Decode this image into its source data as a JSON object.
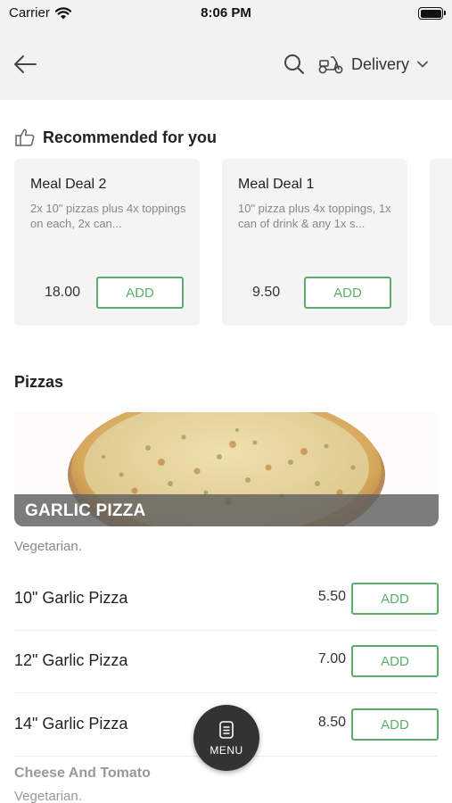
{
  "status_bar": {
    "carrier": "Carrier",
    "time": "8:06 PM"
  },
  "nav": {
    "delivery_label": "Delivery"
  },
  "recommended": {
    "title": "Recommended for you",
    "items": [
      {
        "name": "Meal Deal 2",
        "description": "2x 10\" pizzas plus 4x toppings on each, 2x can...",
        "price": "18.00",
        "add_label": "ADD"
      },
      {
        "name": "Meal Deal 1",
        "description": "10\" pizza plus 4x toppings, 1x can of drink & any 1x s...",
        "price": "9.50",
        "add_label": "ADD"
      }
    ]
  },
  "category": {
    "section_title": "Pizzas",
    "banner_title": "GARLIC PIZZA",
    "description": "Vegetarian.",
    "items": [
      {
        "name": "10\" Garlic Pizza",
        "price": "5.50",
        "add_label": "ADD"
      },
      {
        "name": "12\" Garlic Pizza",
        "price": "7.00",
        "add_label": "ADD"
      },
      {
        "name": "14\" Garlic Pizza",
        "price": "8.50",
        "add_label": "ADD"
      }
    ]
  },
  "next_category": {
    "title": "Cheese And Tomato",
    "description": "Vegetarian."
  },
  "menu_button": {
    "label": "MENU"
  },
  "colors": {
    "accent_green": "#5aae6c",
    "nav_background": "#f2f2f2",
    "fab_background": "#333333"
  },
  "icons": {
    "back": "back-arrow-icon",
    "search": "search-icon",
    "delivery": "scooter-icon",
    "chevron": "chevron-down-icon",
    "recommended": "thumbs-up-icon",
    "menu": "menu-list-icon",
    "wifi": "wifi-icon",
    "battery": "battery-icon"
  }
}
